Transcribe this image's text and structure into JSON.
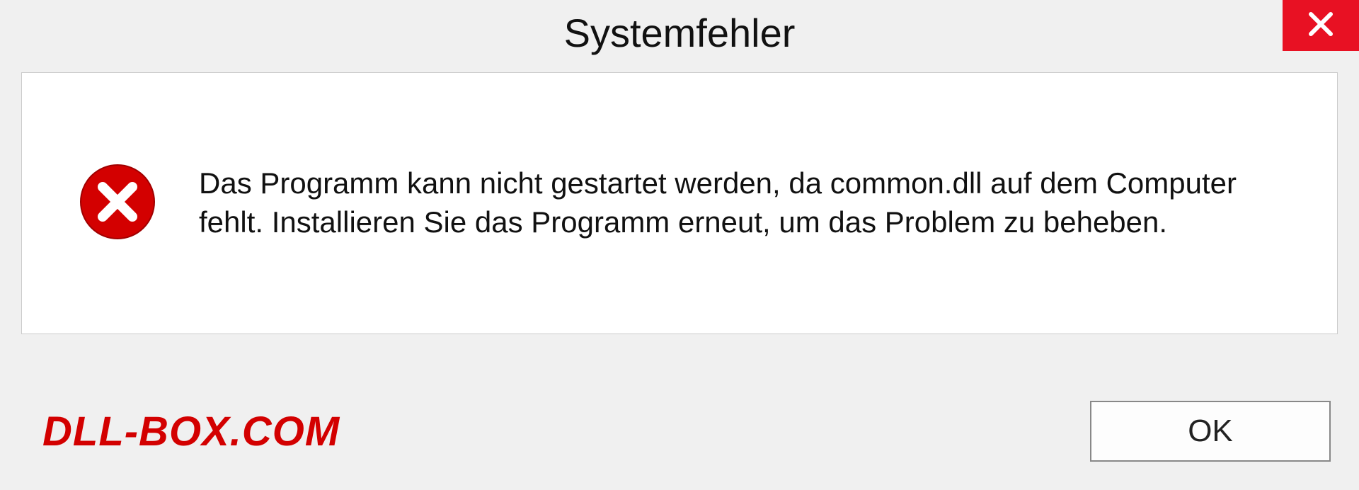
{
  "dialog": {
    "title": "Systemfehler",
    "message": "Das Programm kann nicht gestartet werden, da common.dll auf dem Computer fehlt. Installieren Sie das Programm erneut, um das Problem zu beheben.",
    "ok_label": "OK"
  },
  "watermark": "DLL-BOX.COM",
  "icons": {
    "close": "close-icon",
    "error": "error-circle-x-icon"
  },
  "colors": {
    "close_bg": "#e81123",
    "error_red": "#d30000",
    "watermark_red": "#d30000"
  }
}
